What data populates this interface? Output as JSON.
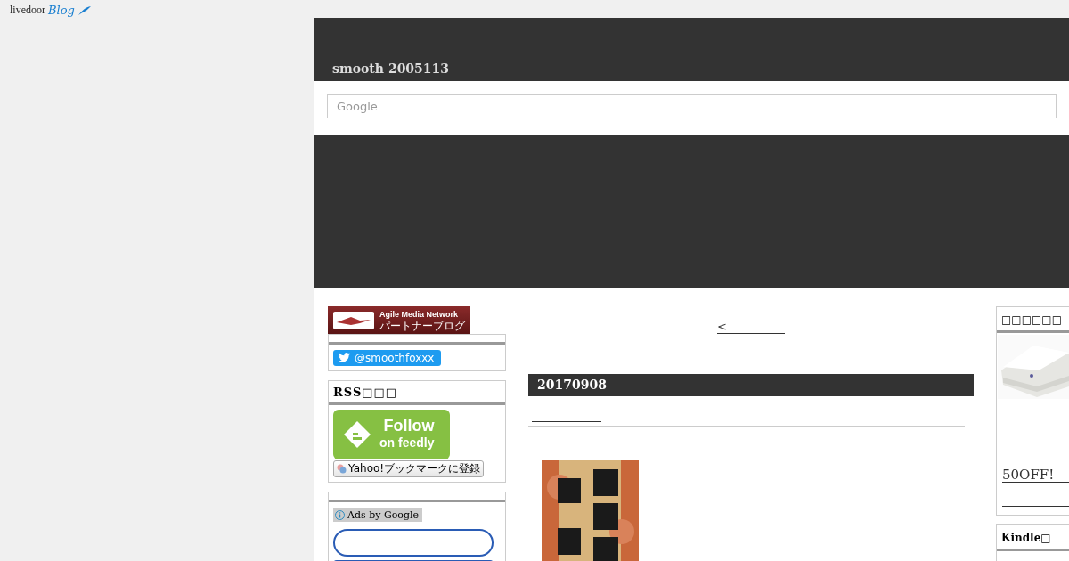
{
  "brand": {
    "name": "livedoor",
    "product": "Blog"
  },
  "blog": {
    "title": "smooth 2005113"
  },
  "search": {
    "placeholder": "Google"
  },
  "left_sidebar": {
    "partner_banner": {
      "title": "Agile Media Network",
      "subtitle": "パートナーブログ"
    },
    "twitter": {
      "handle": "@smoothfoxxx"
    },
    "rss": {
      "heading": "RSS□□□",
      "feedly_title": "Follow",
      "feedly_subtitle": "on feedly",
      "yahoo": "Yahoo!ブックマークに登録"
    },
    "ads": {
      "label": "Ads by Google"
    }
  },
  "main": {
    "prev_link": "<",
    "date": "20170908"
  },
  "right_sidebar": {
    "widgets": [
      {
        "kind": "product",
        "heading": "□□□□□□",
        "link": "50OFF!"
      },
      {
        "kind": "kindle",
        "heading": "Kindle□"
      }
    ]
  }
}
